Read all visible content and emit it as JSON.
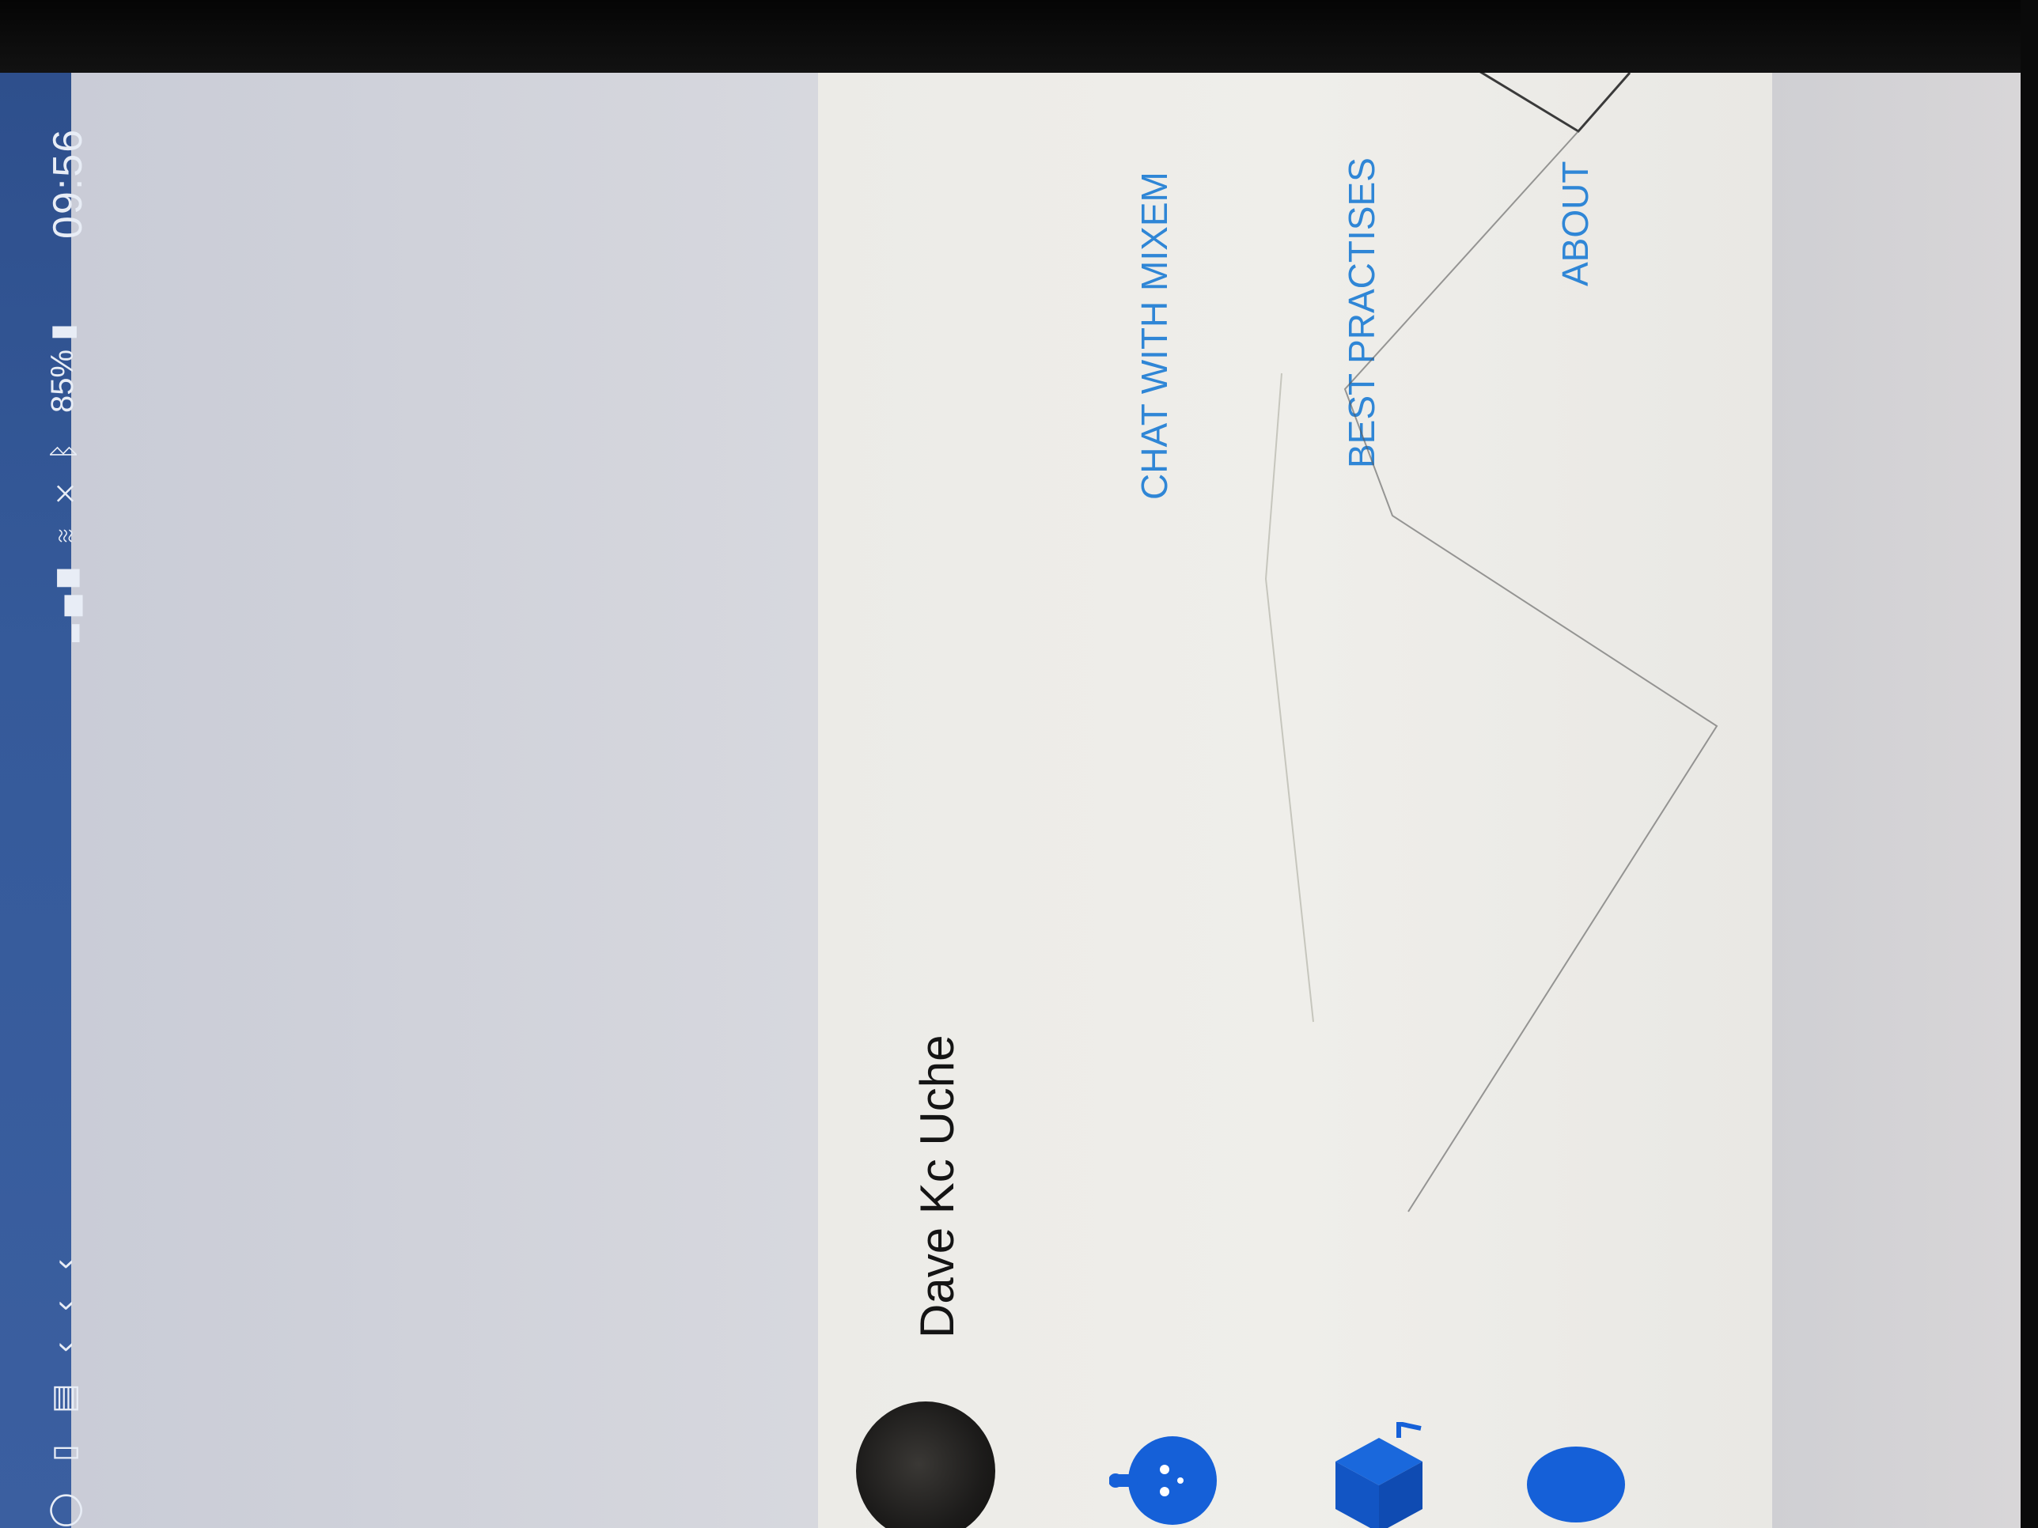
{
  "status_bar": {
    "time": "09:56",
    "battery": "85%",
    "icons_right": [
      "bluetooth-icon",
      "mute-icon",
      "wifi-icon",
      "signal-icon",
      "battery-icon"
    ],
    "icons_left": [
      "chevron-icons",
      "sd-card-icon",
      "notification-icon"
    ]
  },
  "drawer": {
    "profile": {
      "name": "Dave Kc Uche"
    },
    "items": [
      {
        "label": "CHAT WITH MIXEM",
        "icon": "robot-icon"
      },
      {
        "label": "BEST PRACTISES",
        "icon": "box-icon"
      },
      {
        "label": "ABOUT",
        "icon": "egg-icon"
      }
    ]
  },
  "colors": {
    "status_bar": "#355a9a",
    "accent": "#2f86d6",
    "icon_blue": "#1560d8",
    "drawer_bg": "#eeede9"
  }
}
